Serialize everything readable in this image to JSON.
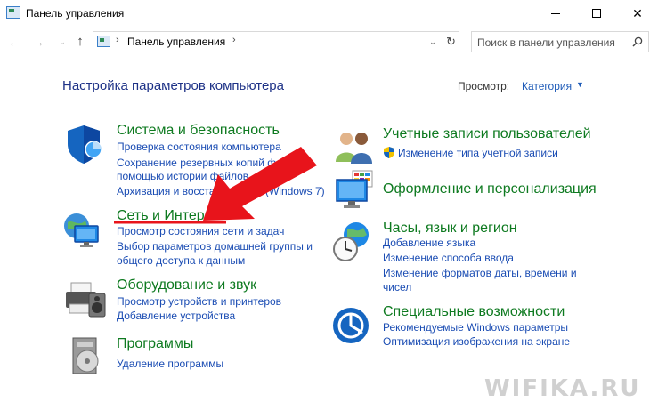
{
  "window": {
    "title": "Панель управления",
    "minimize_glyph": "",
    "close_glyph": "✕"
  },
  "nav": {
    "back_glyph": "←",
    "forward_glyph": "→",
    "recent_glyph": "⌄",
    "up_glyph": "↑",
    "address_sep": "›",
    "address_path": "Панель управления",
    "dropdown_glyph": "⌄",
    "refresh_glyph": "↻",
    "search_placeholder": "Поиск в панели управления"
  },
  "header": {
    "title": "Настройка параметров компьютера",
    "view_label": "Просмотр:",
    "view_value": "Категория",
    "view_caret": "▼"
  },
  "categories": [
    {
      "icon": "shield-icon",
      "title": "Система и безопасность",
      "links": [
        "Проверка состояния компьютера",
        "Сохранение резервных копий файлов",
        "помощью истории файлов",
        "Архивация и восстановление (Windows 7)"
      ]
    },
    {
      "icon": "network-icon",
      "title": "Сеть и Интернет",
      "links": [
        "Просмотр состояния сети и задач",
        "Выбор параметров домашней группы и",
        "общего доступа к данным"
      ]
    },
    {
      "icon": "printer-icon",
      "title": "Оборудование и звук",
      "links": [
        "Просмотр устройств и принтеров",
        "Добавление устройства"
      ]
    },
    {
      "icon": "programs-icon",
      "title": "Программы",
      "links": [
        "Удаление программы"
      ]
    },
    {
      "icon": "users-icon",
      "title": "Учетные записи пользователей",
      "links": [
        "Изменение типа учетной записи"
      ]
    },
    {
      "icon": "appearance-icon",
      "title": "Оформление и персонализация",
      "links": []
    },
    {
      "icon": "clock-globe-icon",
      "title": "Часы, язык и регион",
      "links": [
        "Добавление языка",
        "Изменение способа ввода",
        "Изменение форматов даты, времени и",
        "чисел"
      ]
    },
    {
      "icon": "accessibility-icon",
      "title": "Специальные возможности",
      "links": [
        "Рекомендуемые Windows параметры",
        "Оптимизация изображения на экране"
      ]
    }
  ],
  "colors": {
    "title_green": "#0e7a20",
    "link_blue": "#1a4cb3",
    "header_blue": "#1e3287",
    "annotation_red": "#e8141b"
  },
  "watermark": "WIFIKA.RU"
}
